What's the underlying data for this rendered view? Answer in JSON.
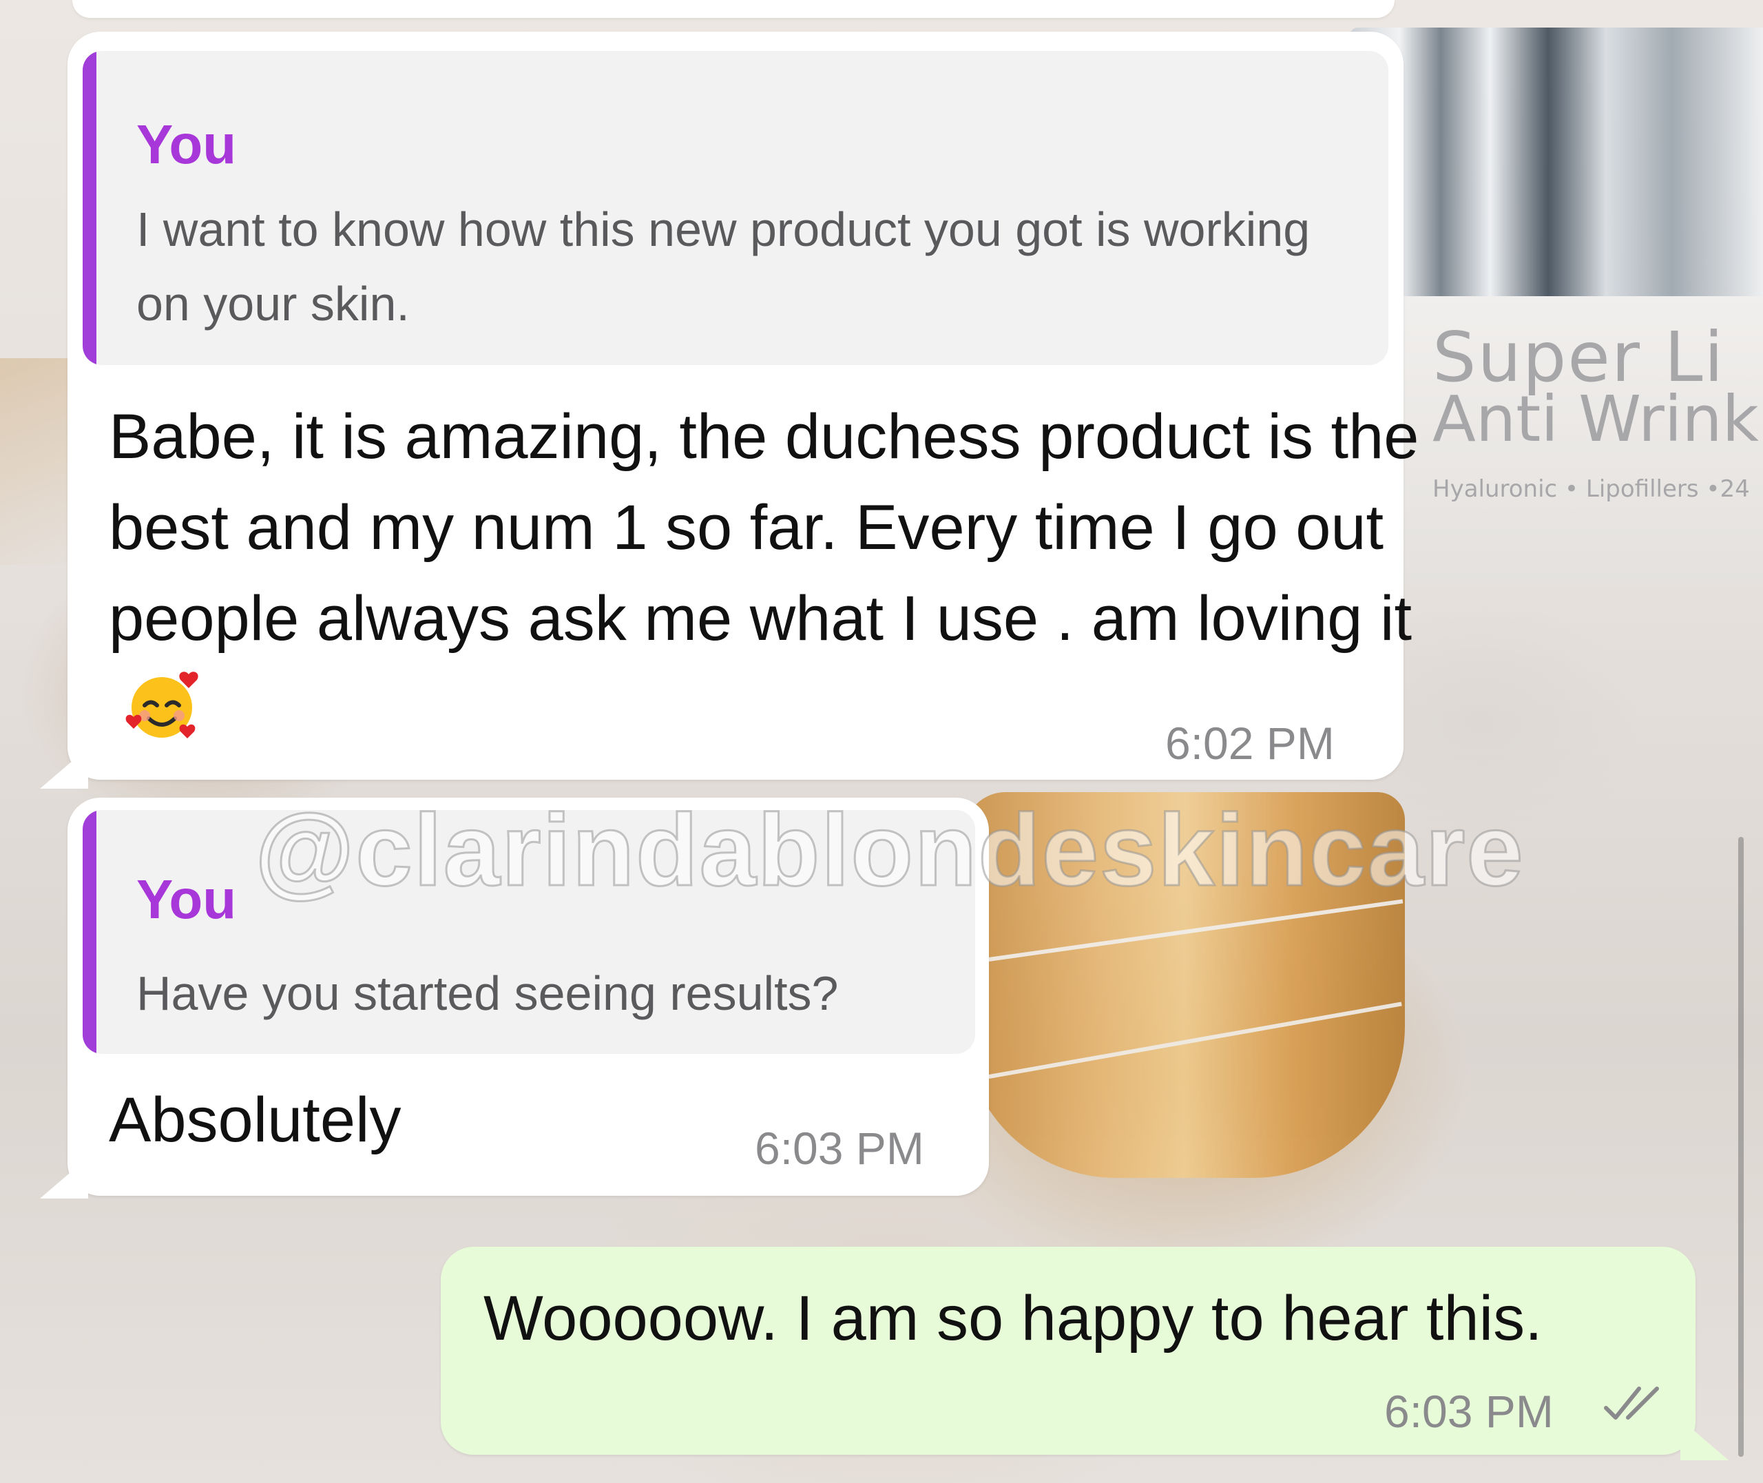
{
  "background": {
    "jar_brand": "Super Li",
    "jar_product": "Anti Wrinkle",
    "jar_ingredients": "Hyaluronic • Lipofillers •24"
  },
  "messages": [
    {
      "quote_author": "You",
      "quote_text": "I want to know how this new product you got is working on your skin.",
      "text": "Babe, it is amazing, the duchess product is the best and my num 1 so far. Every time I go out people always ask me what I use . am loving it",
      "emoji": "smiling-face-with-hearts",
      "time": "6:02 PM"
    },
    {
      "quote_author": "You",
      "quote_text": "Have you started seeing results?",
      "text": "Absolutely",
      "time": "6:03 PM"
    },
    {
      "text": "Wooooow. I am so happy to hear this.",
      "time": "6:03 PM",
      "status": "read"
    }
  ],
  "watermark": "@clarindablondeskincare",
  "colors": {
    "incoming_bubble": "#ffffff",
    "outgoing_bubble": "#e7fbd8",
    "quote_accent": "#a13ed9",
    "quote_author": "#a737d9",
    "timestamp": "#8a8a8d"
  }
}
